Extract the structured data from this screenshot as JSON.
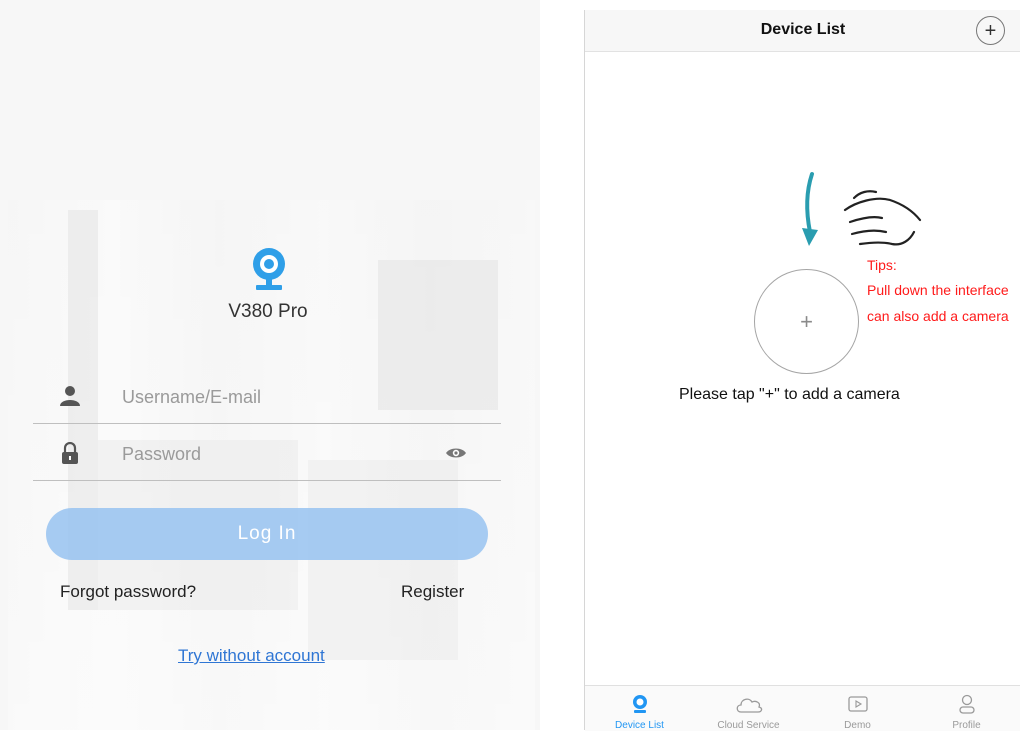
{
  "login": {
    "app_name": "V380 Pro",
    "username_placeholder": "Username/E-mail",
    "password_placeholder": "Password",
    "login_label": "Log In",
    "forgot_label": "Forgot password?",
    "register_label": "Register",
    "try_label": "Try without account"
  },
  "device_list": {
    "title": "Device List",
    "add_symbol": "+",
    "tips_title": "Tips:",
    "tips_line1": "Pull down the interface",
    "tips_line2": "can also add a camera",
    "empty_hint": "Please tap \"+\"  to add a camera"
  },
  "tabs": [
    {
      "label": "Device List",
      "icon": "camera-icon",
      "active": true
    },
    {
      "label": "Cloud Service",
      "icon": "cloud-icon",
      "active": false
    },
    {
      "label": "Demo",
      "icon": "play-icon",
      "active": false
    },
    {
      "label": "Profile",
      "icon": "person-icon",
      "active": false
    }
  ],
  "colors": {
    "accent": "#2196f3",
    "login_button": "#94c1f0",
    "tips_red": "#ff1a1a",
    "link_blue": "#2f76d4",
    "arrow_teal": "#2a9db0"
  }
}
